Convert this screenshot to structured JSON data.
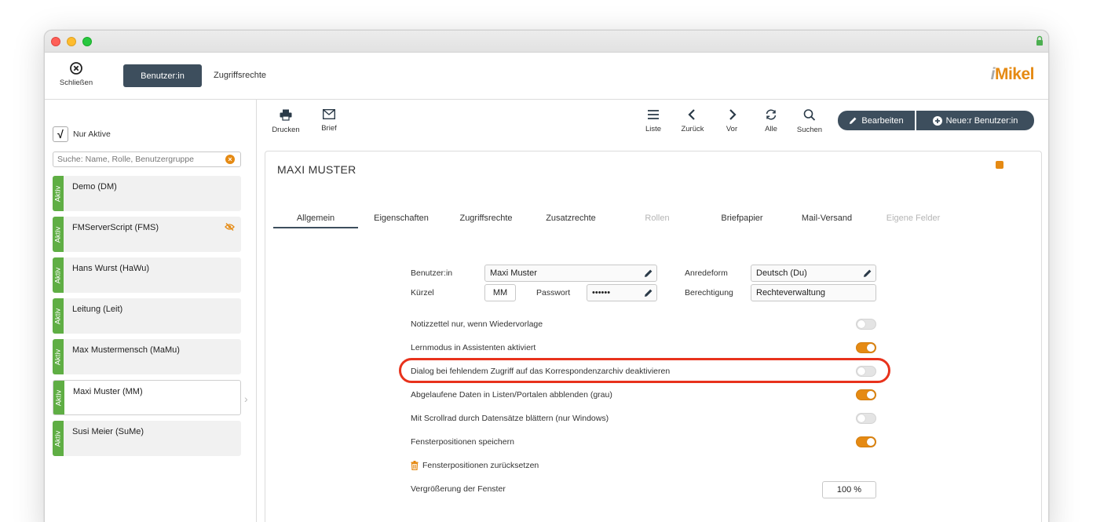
{
  "header": {
    "close_label": "Schließen",
    "tab_user": "Benutzer:in",
    "tab_access": "Zugriffsrechte",
    "logo_prefix": "i",
    "logo_text": "Mikel"
  },
  "sidebar": {
    "only_active_label": "Nur Aktive",
    "only_active_checked": true,
    "checkmark": "√",
    "search_placeholder": "Suche: Name, Rolle, Benutzergruppe",
    "search_value": "",
    "status_label": "Aktiv",
    "users": [
      {
        "name": "Demo (DM)"
      },
      {
        "name": "FMServerScript (FMS)",
        "hidden": true
      },
      {
        "name": "Hans Wurst (HaWu)"
      },
      {
        "name": "Leitung (Leit)"
      },
      {
        "name": "Max Mustermensch (MaMu)"
      },
      {
        "name": "Maxi Muster (MM)",
        "selected": true
      },
      {
        "name": "Susi Meier (SuMe)"
      }
    ]
  },
  "actions": {
    "print": "Drucken",
    "letter": "Brief",
    "list": "Liste",
    "back": "Zurück",
    "forward": "Vor",
    "all": "Alle",
    "search": "Suchen",
    "edit": "Bearbeiten",
    "new_user": "Neue:r Benutzer:in"
  },
  "record": {
    "title": "MAXI MUSTER",
    "tabs": [
      {
        "label": "Allgemein",
        "active": true
      },
      {
        "label": "Eigenschaften"
      },
      {
        "label": "Zugriffsrechte"
      },
      {
        "label": "Zusatzrechte"
      },
      {
        "label": "Rollen",
        "disabled": true
      },
      {
        "label": "Briefpapier"
      },
      {
        "label": "Mail-Versand"
      },
      {
        "label": "Eigene Felder",
        "disabled": true
      }
    ],
    "form": {
      "user_label": "Benutzer:in",
      "user_value": "Maxi Muster",
      "salutation_label": "Anredeform",
      "salutation_value": "Deutsch (Du)",
      "short_label": "Kürzel",
      "short_value": "MM",
      "password_label": "Passwort",
      "password_value": "••••••",
      "permission_label": "Berechtigung",
      "permission_value": "Rechteverwaltung"
    },
    "settings": [
      {
        "label": "Notizzettel nur, wenn Wiedervorlage",
        "on": false
      },
      {
        "label": "Lernmodus in Assistenten aktiviert",
        "on": true
      },
      {
        "label": "Dialog bei fehlendem Zugriff auf das Korrespondenzarchiv deaktivieren",
        "on": false
      },
      {
        "label": "Abgelaufene Daten in Listen/Portalen abblenden (grau)",
        "on": true
      },
      {
        "label": "Mit Scrollrad durch Datensätze blättern (nur Windows)",
        "on": false
      },
      {
        "label": "Fensterpositionen speichern",
        "on": true
      }
    ],
    "reset_positions": "Fensterpositionen zurücksetzen",
    "zoom_label": "Vergrößerung der Fenster",
    "zoom_value": "100 %"
  },
  "colors": {
    "accent": "#e58a13",
    "dark_button": "#3d4e5d",
    "active_green": "#5fae44",
    "highlight": "#e8321c"
  }
}
